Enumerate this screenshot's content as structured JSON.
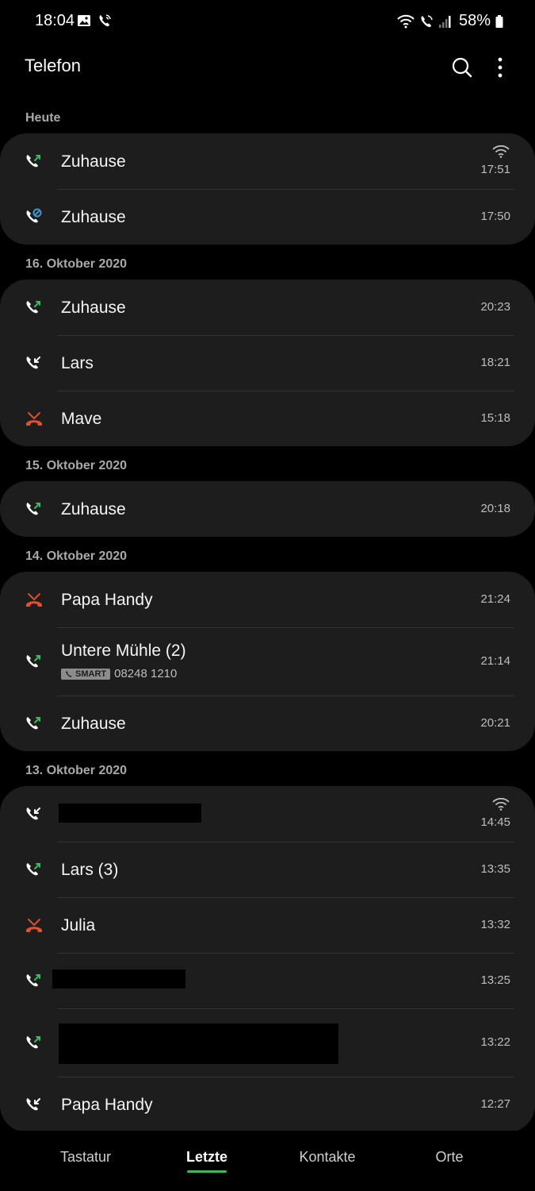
{
  "status_bar": {
    "time": "18:04",
    "battery": "58%",
    "left_icons": [
      "gallery-icon",
      "wifi-call-icon"
    ],
    "right_icons": [
      "wifi-icon",
      "wifi-call-icon",
      "signal-icon",
      "battery-icon"
    ]
  },
  "app_bar": {
    "title": "Telefon",
    "actions": [
      "search-icon",
      "more-options-icon"
    ]
  },
  "colors": {
    "background": "#000000",
    "card": "#1d1d1d",
    "outgoing": "#3fb75e",
    "missed": "#e0502c",
    "incoming": "#ffffff",
    "blocked": "#3a97d4",
    "nav_active_underline": "#3fb75e"
  },
  "call_log": [
    {
      "date": "Heute",
      "calls": [
        {
          "type": "outgoing",
          "name": "Zuhause",
          "time": "17:51",
          "wifi_call": true
        },
        {
          "type": "blocked",
          "name": "Zuhause",
          "time": "17:50"
        }
      ]
    },
    {
      "date": "16. Oktober 2020",
      "calls": [
        {
          "type": "outgoing",
          "name": "Zuhause",
          "time": "20:23"
        },
        {
          "type": "incoming",
          "name": "Lars",
          "time": "18:21"
        },
        {
          "type": "missed",
          "name": "Mave",
          "time": "15:18"
        }
      ]
    },
    {
      "date": "15. Oktober 2020",
      "calls": [
        {
          "type": "outgoing",
          "name": "Zuhause",
          "time": "20:18"
        }
      ]
    },
    {
      "date": "14. Oktober 2020",
      "calls": [
        {
          "type": "missed",
          "name": "Papa Handy",
          "time": "21:24"
        },
        {
          "type": "outgoing",
          "name": "Untere Mühle (2)",
          "time": "21:14",
          "badge": "SMART",
          "number": "08248 1210"
        },
        {
          "type": "outgoing",
          "name": "Zuhause",
          "time": "20:21"
        }
      ]
    },
    {
      "date": "13. Oktober 2020",
      "calls": [
        {
          "type": "incoming",
          "name": "",
          "time": "14:45",
          "wifi_call": true,
          "redacted": true
        },
        {
          "type": "outgoing",
          "name": "Lars (3)",
          "time": "13:35"
        },
        {
          "type": "missed",
          "name": "Julia",
          "time": "13:32"
        },
        {
          "type": "outgoing",
          "name": "",
          "time": "13:25",
          "redacted": true
        },
        {
          "type": "outgoing",
          "name": "",
          "time": "13:22",
          "redacted": true
        },
        {
          "type": "incoming",
          "name": "Papa Handy",
          "time": "12:27"
        }
      ]
    }
  ],
  "bottom_nav": {
    "items": [
      {
        "label": "Tastatur",
        "active": false
      },
      {
        "label": "Letzte",
        "active": true
      },
      {
        "label": "Kontakte",
        "active": false
      },
      {
        "label": "Orte",
        "active": false
      }
    ]
  }
}
